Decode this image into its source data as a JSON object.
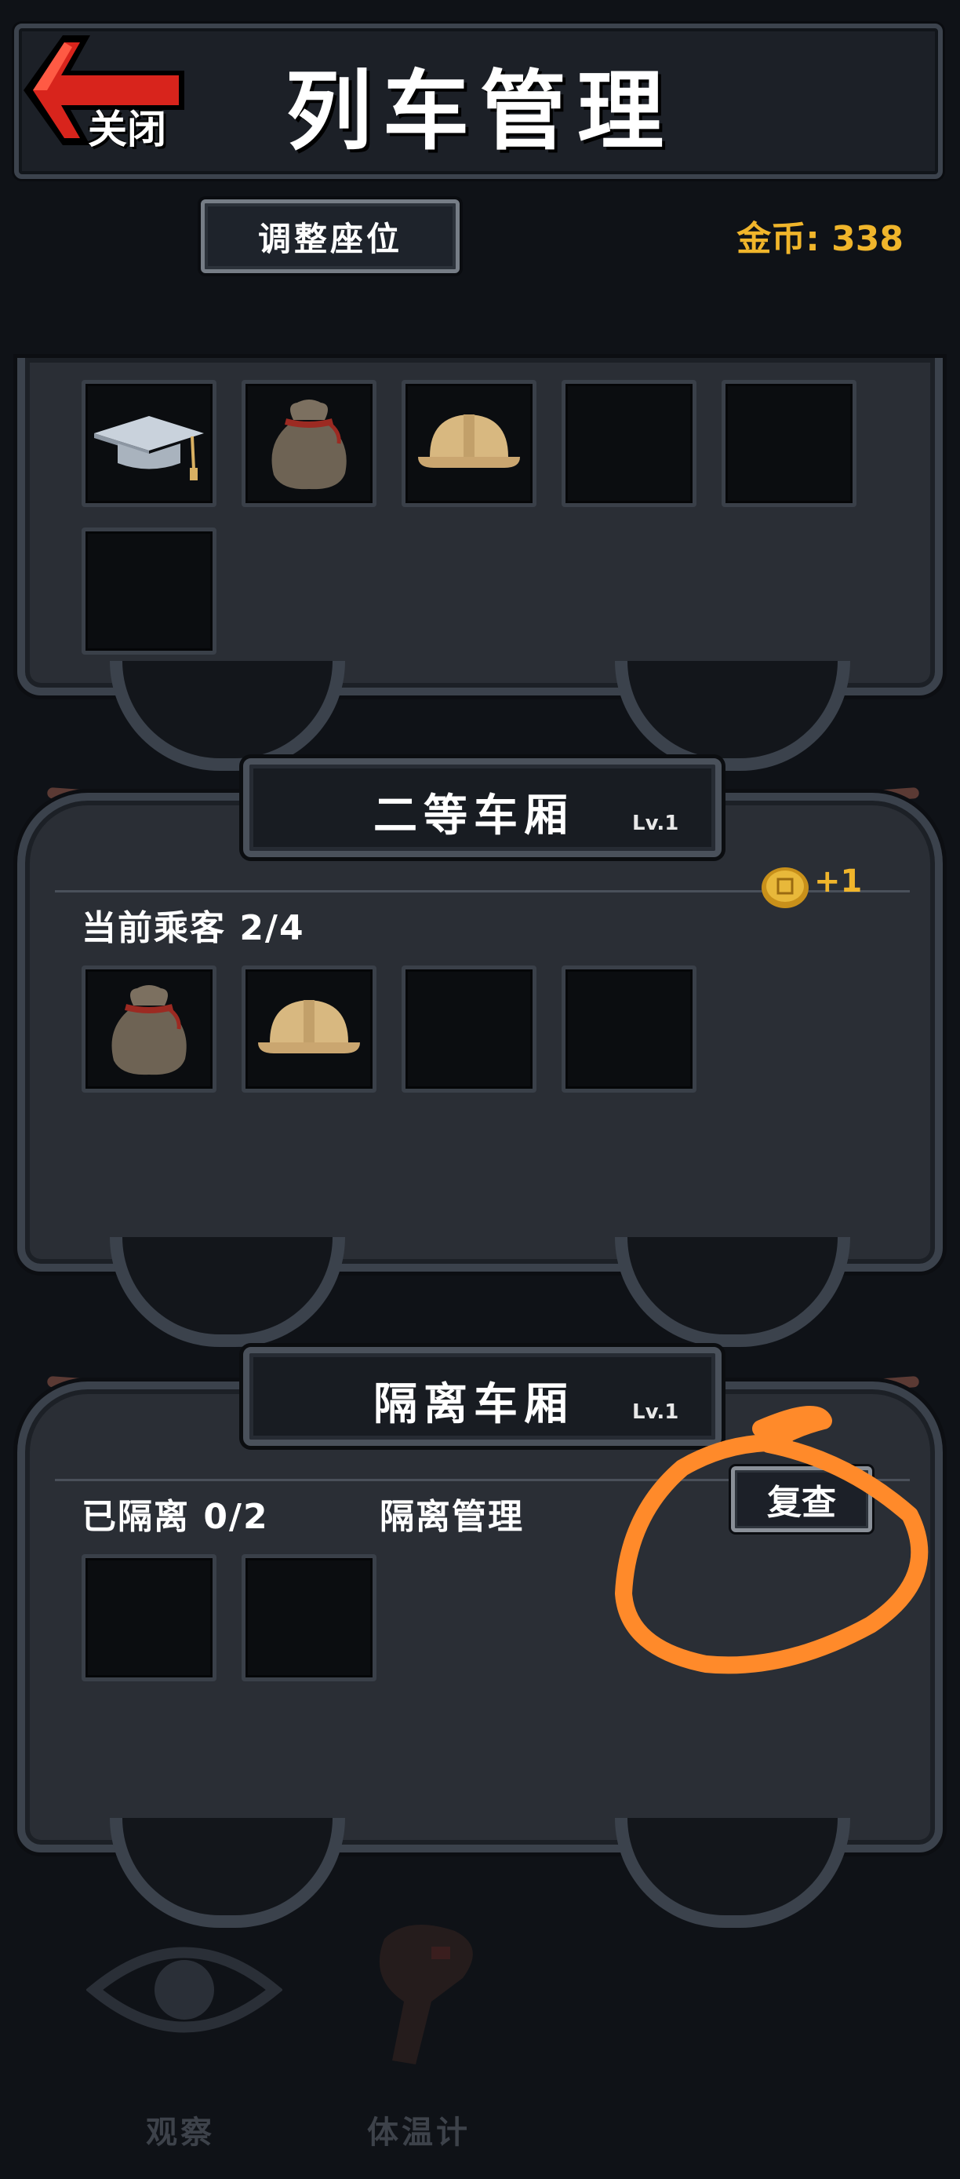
{
  "header": {
    "back_label": "关闭",
    "title": "列车管理"
  },
  "controls": {
    "adjust_seats": "调整座位",
    "coins": "金币: 338"
  },
  "car_top": {
    "slots": [
      "graduation-cap-icon",
      "money-bag-icon",
      "hard-hat-icon",
      "",
      "",
      ""
    ]
  },
  "car_second": {
    "title": "二等车厢",
    "level": "Lv.1",
    "passengers_label": "当前乘客 2/4",
    "bonus": "+1",
    "slots": [
      "money-bag-icon",
      "hard-hat-icon",
      "",
      ""
    ]
  },
  "car_isolation": {
    "title": "隔离车厢",
    "level": "Lv.1",
    "isolated_label": "已隔离 0/2",
    "management_label": "隔离管理",
    "recheck_label": "复查",
    "slots": [
      "",
      ""
    ]
  },
  "bottom_bar": {
    "observe_label": "观察",
    "thermometer_label": "体温计"
  },
  "colors": {
    "coin_gold": "#f0b52b",
    "annotation": "#ff8a2a",
    "arrow_red": "#e0342a"
  }
}
